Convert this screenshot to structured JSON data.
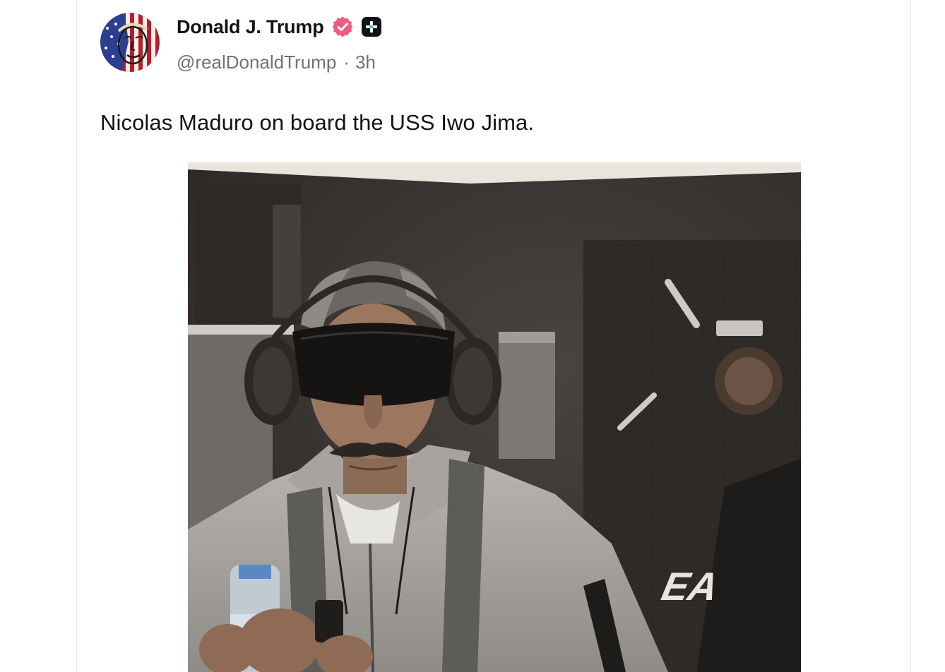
{
  "post": {
    "author": {
      "display_name": "Donald J. Trump",
      "handle": "@realDonaldTrump",
      "verified_icon": "verified-check-icon",
      "verified_color": "#f05a7e",
      "plus_icon": "plus-badge-icon"
    },
    "separator": "·",
    "time_ago": "3h",
    "text": "Nicolas Maduro on board the USS Iwo Jima.",
    "media": {
      "type": "photo",
      "alt": "Nicolas Maduro on board the USS Iwo Jima."
    }
  },
  "colors": {
    "text_primary": "#0f1419",
    "text_secondary": "#6b7280",
    "border": "#e6e7ea"
  }
}
